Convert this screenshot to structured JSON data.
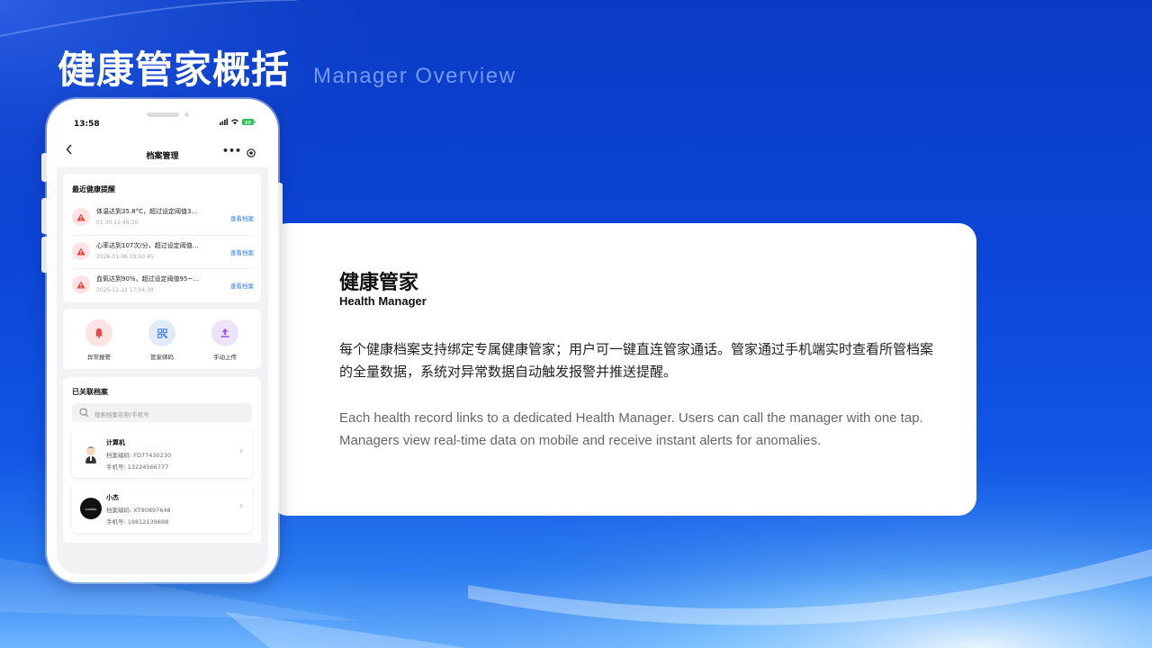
{
  "header": {
    "title": "健康管家概括",
    "subtitle": "Manager Overview"
  },
  "card": {
    "heading": "健康管家",
    "heading_en": "Health Manager",
    "desc_zh": "每个健康档案支持绑定专属健康管家；用户可一键直连管家通话。管家通过手机端实时查看所管档案的全量数据，系统对异常数据自动触发报警并推送提醒。",
    "desc_en": " Each health record links to a dedicated Health Manager. Users can call the manager with one tap. Managers view real-time data on mobile and receive instant alerts for anomalies."
  },
  "phone": {
    "status": {
      "time": "13:58",
      "battery": "88"
    },
    "nav": {
      "title": "档案管理",
      "back_icon": "chevron-left-icon",
      "more": "•••"
    },
    "alerts": {
      "title": "最近健康提醒",
      "items": [
        {
          "text": "体温达到35.8°C，超过设定阈值3…",
          "time": "01-30 12:46:30",
          "link": "查看档案"
        },
        {
          "text": "心率达到107次/分，超过设定阈值…",
          "time": "2026-01-08 19:00:45",
          "link": "查看档案"
        },
        {
          "text": "血氧达到90%，超过设定阈值95~…",
          "time": "2025-12-22 17:04:39",
          "link": "查看档案"
        }
      ]
    },
    "quick_actions": [
      {
        "label": "异常报警",
        "icon": "bell-icon",
        "bg": "#fde3e3",
        "color": "#e8433f"
      },
      {
        "label": "管家绑码",
        "icon": "qrcode-icon",
        "bg": "#e1ebfd",
        "color": "#4a86f0"
      },
      {
        "label": "手动上传",
        "icon": "upload-icon",
        "bg": "#ede3fb",
        "color": "#9b5ae6"
      }
    ],
    "records": {
      "title": "已关联档案",
      "search_placeholder": "搜索档案名称/手机号",
      "items": [
        {
          "name": "计算机",
          "code": "档案编码: FD77430230",
          "phone": "手机号: 13224566777"
        },
        {
          "name": "小杰",
          "code": "档案编码: XT90897648",
          "phone": "手机号: 19812139898",
          "avatar_text": "xunliao"
        }
      ]
    }
  }
}
